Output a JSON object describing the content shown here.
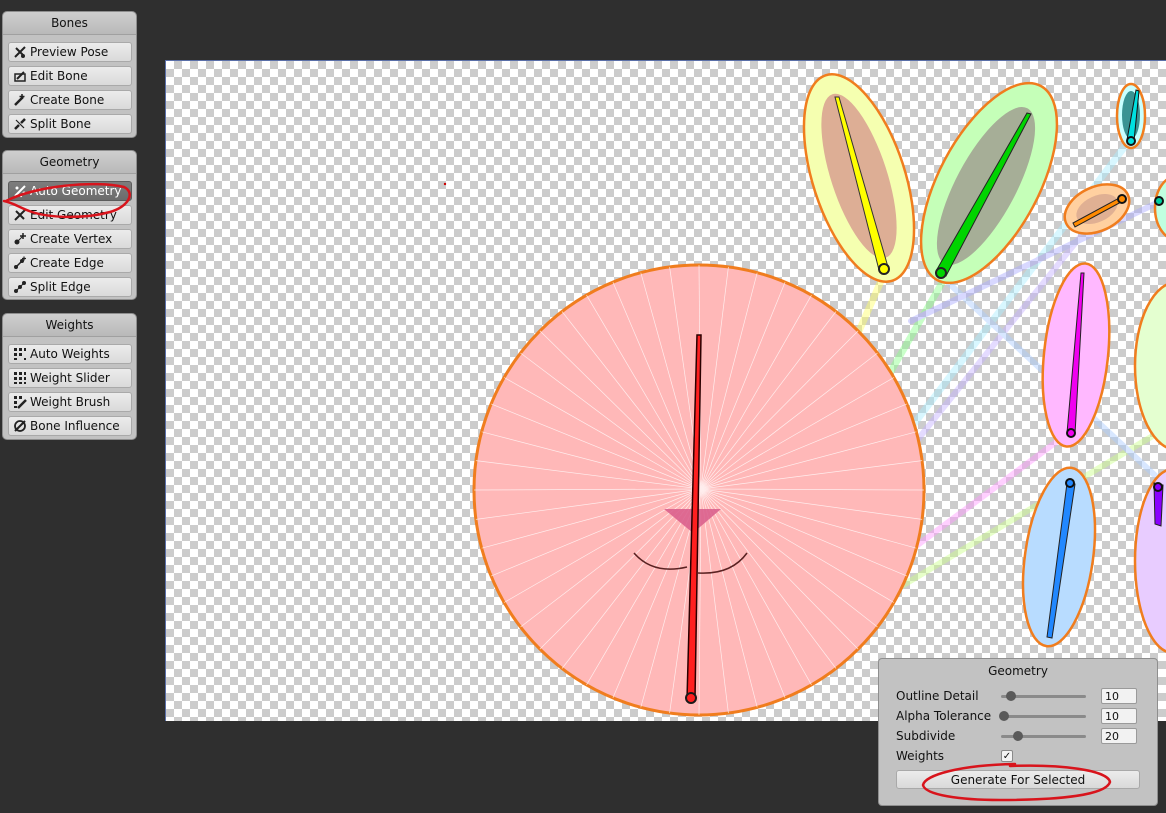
{
  "panels": {
    "bones": {
      "title": "Bones",
      "buttons": [
        {
          "label": "Preview Pose",
          "icon": "preview-pose-icon"
        },
        {
          "label": "Edit Bone",
          "icon": "edit-bone-icon"
        },
        {
          "label": "Create Bone",
          "icon": "create-bone-icon"
        },
        {
          "label": "Split Bone",
          "icon": "split-bone-icon"
        }
      ]
    },
    "geometry": {
      "title": "Geometry",
      "buttons": [
        {
          "label": "Auto Geometry",
          "icon": "auto-geometry-icon",
          "active": true
        },
        {
          "label": "Edit Geometry",
          "icon": "edit-geometry-icon"
        },
        {
          "label": "Create Vertex",
          "icon": "create-vertex-icon"
        },
        {
          "label": "Create Edge",
          "icon": "create-edge-icon"
        },
        {
          "label": "Split Edge",
          "icon": "split-edge-icon"
        }
      ]
    },
    "weights": {
      "title": "Weights",
      "buttons": [
        {
          "label": "Auto Weights",
          "icon": "auto-weights-icon"
        },
        {
          "label": "Weight Slider",
          "icon": "weight-slider-icon"
        },
        {
          "label": "Weight Brush",
          "icon": "weight-brush-icon"
        },
        {
          "label": "Bone Influence",
          "icon": "bone-influence-icon"
        }
      ]
    }
  },
  "geometry_settings": {
    "title": "Geometry",
    "outline_detail": {
      "label": "Outline Detail",
      "value": "10",
      "slider_fraction": 0.12
    },
    "alpha_tolerance": {
      "label": "Alpha Tolerance",
      "value": "10",
      "slider_fraction": 0.04
    },
    "subdivide": {
      "label": "Subdivide",
      "value": "20",
      "slider_fraction": 0.2
    },
    "weights": {
      "label": "Weights",
      "checked": true,
      "check_glyph": "✓"
    },
    "generate_button": "Generate For Selected"
  },
  "colors": {
    "annotation": "#d8141c",
    "mesh_outline": "#f07d1e",
    "active_tool": "#6f6f6f",
    "bones": [
      "#ff1f1f",
      "#ffff00",
      "#00d400",
      "#00d8d8",
      "#ff8a00",
      "#f000f0",
      "#2288ff",
      "#8a00ff"
    ]
  }
}
